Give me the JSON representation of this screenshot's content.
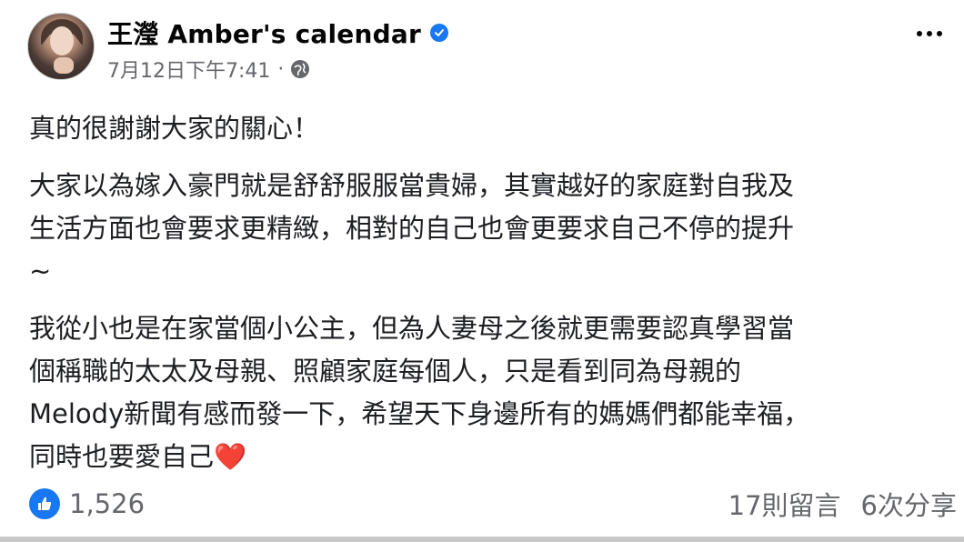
{
  "post": {
    "author": "王瀅 Amber's calendar",
    "timestamp": "7月12日下午7:41",
    "separator": "·",
    "paragraphs": [
      [
        "真的很謝謝大家的關心！"
      ],
      [
        "大家以為嫁入豪門就是舒舒服服當貴婦，其實越好的家庭對自我及",
        "生活方面也會要求更精緻，相對的自己也會更要求自己不停的提升",
        "~"
      ],
      [
        "我從小也是在家當個小公主，但為人妻母之後就更需要認真學習當",
        "個稱職的太太及母親、照顧家庭每個人，只是看到同為母親的",
        "Melody新聞有感而發一下，希望天下身邊所有的媽媽們都能幸福，",
        "同時也要愛自己"
      ]
    ],
    "heart_emoji": "❤️",
    "reactions_count": "1,526",
    "comments": "17則留言",
    "shares": "6次分享"
  },
  "icons": {
    "verified": "verified-badge-icon",
    "privacy": "globe-icon",
    "more": "more-options-icon",
    "like": "like-reaction-icon"
  },
  "colors": {
    "accent": "#1877f2",
    "meta_text": "#65676b",
    "heart": "#e41e3f"
  }
}
